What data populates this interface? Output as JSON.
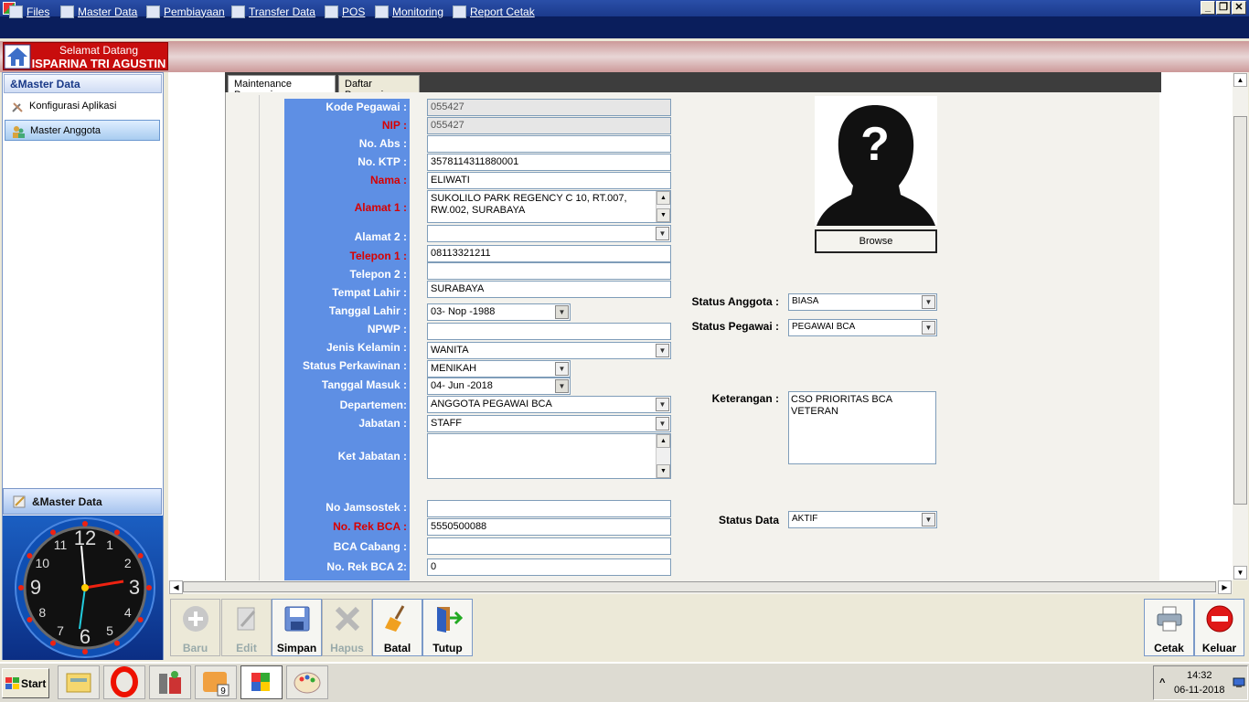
{
  "window": {
    "minimize": "_",
    "restore": "❐",
    "close": "✕"
  },
  "menu": [
    {
      "label": "Files",
      "icon": "files-icon"
    },
    {
      "label": "Master Data",
      "icon": "master-data-icon"
    },
    {
      "label": "Pembiayaan",
      "icon": "pembiayaan-icon"
    },
    {
      "label": "Transfer Data",
      "icon": "transfer-data-icon"
    },
    {
      "label": "POS",
      "icon": "pos-icon"
    },
    {
      "label": "Monitoring",
      "icon": "monitoring-icon"
    },
    {
      "label": "Report Cetak",
      "icon": "report-cetak-icon"
    }
  ],
  "header": {
    "welcome": "Selamat Datang",
    "user": "ISPARINA TRI AGUSTIN"
  },
  "sidebar": {
    "title": "&Master Data",
    "items": [
      {
        "label": "Konfigurasi Aplikasi",
        "icon": "tools-icon"
      },
      {
        "label": "Master Anggota",
        "icon": "members-icon",
        "selected": true
      }
    ],
    "bottom_title": "&Master Data"
  },
  "clock": {
    "numbers": [
      "12",
      "1",
      "2",
      "3",
      "4",
      "5",
      "6",
      "7",
      "8",
      "9",
      "10",
      "11"
    ]
  },
  "tabs": [
    "Maintenance Pegawai",
    "Daftar Pegawai"
  ],
  "form": {
    "kode_pegawai": {
      "label": "Kode Pegawai :",
      "value": "055427"
    },
    "nip": {
      "label": "NIP :",
      "value": "055427"
    },
    "no_abs": {
      "label": "No. Abs :",
      "value": ""
    },
    "no_ktp": {
      "label": "No. KTP :",
      "value": "3578114311880001"
    },
    "nama": {
      "label": "Nama :",
      "value": "ELIWATI"
    },
    "alamat1": {
      "label": "Alamat 1 :",
      "value": "SUKOLILO PARK REGENCY C 10, RT.007, RW.002, SURABAYA"
    },
    "alamat2": {
      "label": "Alamat 2 :",
      "value": ""
    },
    "telepon1": {
      "label": "Telepon 1 :",
      "value": "08113321211"
    },
    "telepon2": {
      "label": "Telepon 2 :",
      "value": ""
    },
    "tempat_lahir": {
      "label": "Tempat Lahir :",
      "value": "SURABAYA"
    },
    "tanggal_lahir": {
      "label": "Tanggal Lahir :",
      "value": "03- Nop -1988"
    },
    "npwp": {
      "label": "NPWP :",
      "value": ""
    },
    "jenis_kelamin": {
      "label": "Jenis Kelamin :",
      "value": "WANITA"
    },
    "status_perkawinan": {
      "label": "Status Perkawinan :",
      "value": "MENIKAH"
    },
    "tanggal_masuk": {
      "label": "Tanggal Masuk :",
      "value": "04- Jun -2018"
    },
    "departemen": {
      "label": "Departemen:",
      "value": "ANGGOTA PEGAWAI BCA"
    },
    "jabatan": {
      "label": "Jabatan :",
      "value": "STAFF"
    },
    "ket_jabatan": {
      "label": "Ket Jabatan :",
      "value": ""
    },
    "no_jamsostek": {
      "label": "No Jamsostek :",
      "value": ""
    },
    "no_rek_bca": {
      "label": "No. Rek BCA :",
      "value": "5550500088"
    },
    "bca_cabang": {
      "label": "BCA Cabang :",
      "value": ""
    },
    "no_rek_bca2": {
      "label": "No. Rek BCA 2:",
      "value": "0"
    }
  },
  "right": {
    "browse": "Browse",
    "status_anggota": {
      "label": "Status Anggota :",
      "value": "BIASA"
    },
    "status_pegawai": {
      "label": "Status Pegawai :",
      "value": "PEGAWAI BCA"
    },
    "keterangan": {
      "label": "Keterangan :",
      "value": "CSO PRIORITAS BCA\nVETERAN"
    },
    "status_data": {
      "label": "Status Data",
      "value": "AKTIF"
    }
  },
  "toolbar": {
    "baru": "Baru",
    "edit": "Edit",
    "simpan": "Simpan",
    "hapus": "Hapus",
    "batal": "Batal",
    "tutup": "Tutup",
    "cetak": "Cetak",
    "keluar": "Keluar"
  },
  "taskbar": {
    "start": "Start",
    "time": "14:32",
    "date": "06-11-2018",
    "tray_chevron": "^"
  },
  "colors": {
    "label_column": "#5e8fe4",
    "required_label": "#d80000",
    "welcome_box": "#c80d0d",
    "menubar": "#0a1e5c"
  }
}
